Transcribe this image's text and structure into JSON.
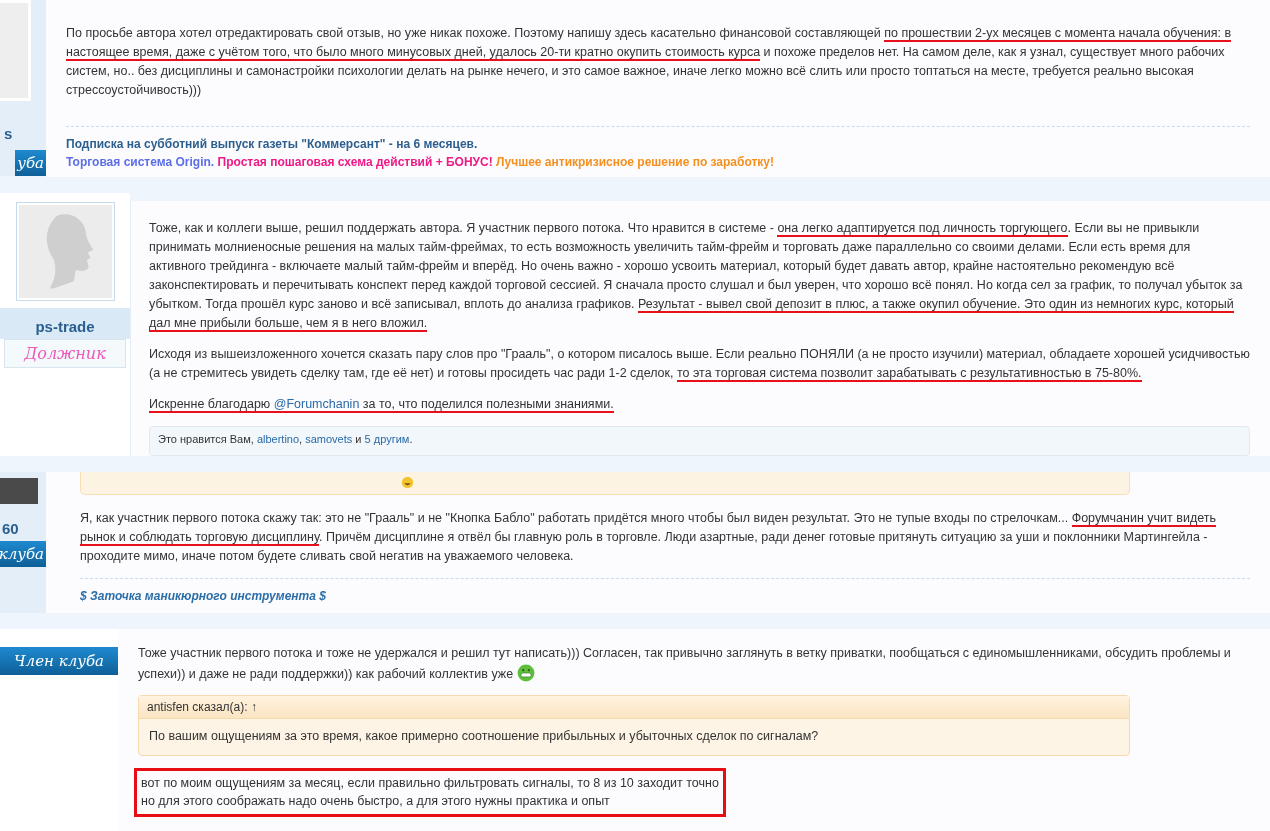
{
  "posts": [
    {
      "author": {
        "name": "s",
        "rank": {
          "text": "уба",
          "kind": "ribbon"
        },
        "avatar": {
          "kind": "blank"
        }
      },
      "paragraphs": [
        {
          "segments": [
            {
              "text": "По просьбе автора хотел отредактировать свой отзыв, но уже никак похоже. Поэтому напишу здесь касательно финансовой составляющей ",
              "marked": false
            },
            {
              "text": "по прошествии 2-ух месяцев с момента начала обучения: в настоящее время, даже с учётом того, что было много минусовых дней, удалось 20-ти кратно окупить стоимость курса",
              "marked": true
            },
            {
              "text": " и похоже пределов нет. На самом деле, как я узнал, существует много рабочих систем, но.. без дисциплины и самонастройки психологии делать на рынке нечего, и это самое важное, иначе легко можно всё слить или просто топтаться на месте, требуется реально высокая стрессоустойчивость)))",
              "marked": false
            }
          ]
        }
      ],
      "signature": [
        {
          "kind": "bold",
          "parts": [
            {
              "text": "Подписка на субботний выпуск газеты \"Коммерсант\" - на 6 месяцев.",
              "color": "#2d5f8e"
            }
          ]
        },
        {
          "kind": "bold",
          "parts": [
            {
              "text": "Торговая система Origin.",
              "color": "#5b6ee8"
            },
            {
              "text": "Простая пошаговая схема действий + БОНУС!",
              "color": "#ee1a86"
            },
            {
              "text": "Лучшее антикризисное решение по заработку!",
              "color": "#f5901e"
            }
          ]
        }
      ]
    },
    {
      "author": {
        "name": "ps-trade",
        "rank": {
          "text": "Должник",
          "kind": "plain"
        },
        "avatar": {
          "kind": "silhouette"
        }
      },
      "paragraphs": [
        {
          "segments": [
            {
              "text": "Тоже, как и коллеги выше, решил поддержать автора. Я участник первого потока. Что нравится в системе - ",
              "marked": false
            },
            {
              "text": "она легко адаптируется под личность торгующего",
              "marked": true
            },
            {
              "text": ". Если вы не привыкли принимать молниеносные решения на малых тайм-фреймах, то есть возможность увеличить тайм-фрейм и торговать даже параллельно со своими делами. Если есть время для активного трейдинга - включаете малый тайм-фрейм и вперёд. Но очень важно - хорошо усвоить материал, который будет давать автор, крайне настоятельно рекомендую всё законспектировать и перечитывать конспект перед каждой торговой сессией. Я сначала просто слушал и был уверен, что хорошо всё понял. Но когда сел за график, то получал убыток за убытком. Тогда прошёл курс заново и всё записывал, вплоть до анализа графиков. ",
              "marked": false
            },
            {
              "text": "Результат - вывел свой депозит в плюс, а также окупил обучение. Это один из немногих курс, который дал мне прибыли больше, чем я в него вложил.",
              "marked": true
            }
          ]
        },
        {
          "segments": [
            {
              "text": "Исходя из вышеизложенного хочется сказать пару слов про \"Грааль\", о котором писалось выше. Если реально ПОНЯЛИ (а не просто изучили) материал, обладаете хорошей усидчивостью (а не стремитесь увидеть сделку там, где её нет) и готовы просидеть час ради 1-2 сделок, ",
              "marked": false
            },
            {
              "text": "то эта торговая система позволит зарабатывать с результативностью в 75-80%.",
              "marked": true
            }
          ]
        },
        {
          "segments": [
            {
              "text": "Искренне благодарю ",
              "marked": true
            },
            {
              "text": "@Forumchanin",
              "marked": true,
              "link": true
            },
            {
              "text": " за то, что поделился полезными знаниями.",
              "marked": true
            }
          ]
        }
      ],
      "likes": [
        {
          "text": "Это нравится ",
          "link": false
        },
        {
          "text": "Вам",
          "link": false
        },
        {
          "text": ", ",
          "link": false
        },
        {
          "text": "albertino",
          "link": true
        },
        {
          "text": ", ",
          "link": false
        },
        {
          "text": "samovets",
          "link": true
        },
        {
          "text": " и ",
          "link": false
        },
        {
          "text": "5 другим",
          "link": true
        },
        {
          "text": ".",
          "link": false
        }
      ]
    },
    {
      "author": {
        "name": "60",
        "rank": {
          "text": "клуба",
          "kind": "ribbon"
        },
        "avatar": {
          "kind": "photo"
        }
      },
      "quote_stub": true,
      "paragraphs": [
        {
          "segments": [
            {
              "text": "Я, как участник первого потока скажу так: это не \"Грааль\" и не \"Кнопка Бабло\" работать придётся много чтобы был виден результат. Это не тупые входы по стрелочкам... ",
              "marked": false
            },
            {
              "text": "Форумчанин учит видеть рынок и соблюдать торговую дисциплину",
              "marked": true
            },
            {
              "text": ". Причём дисциплине я отвёл бы главную роль в торговле. Люди азартные, ради денег готовые притянуть ситуацию за уши и поклонники Мартингейла - проходите мимо, иначе потом будете сливать свой негатив на уважаемого человека.",
              "marked": false
            }
          ]
        }
      ],
      "signature": [
        {
          "kind": "italic",
          "parts": [
            {
              "text": "$ Заточка маникюрного инструмента $",
              "color": "#2c6ea8"
            }
          ]
        }
      ]
    },
    {
      "author": {
        "rank": {
          "text": "Член клуба",
          "kind": "ribbon"
        }
      },
      "paragraphs": [
        {
          "smiley": true,
          "segments": [
            {
              "text": "Тоже участник первого потока и тоже не удержался и решил тут написать))) Согласен, так привычно заглянуть в ветку приватки, пообщаться с единомышленниками, обсудить проблемы и успехи)) и даже не ради поддержки)) как рабочий коллектив уже",
              "marked": false
            }
          ]
        }
      ],
      "quote": {
        "author": "antisfen сказал(а): ↑",
        "text": "По вашим ощущениям за это время, какое примерно соотношение прибыльных и убыточных сделок по сигналам?"
      },
      "answer": {
        "boxed": true,
        "lines": [
          "вот по моим ощущениям за месяц, если правильно фильтровать сигналы, то 8 из 10 заходит точно",
          "но для этого соображать надо очень быстро, а для этого нужны практика и опыт"
        ]
      }
    }
  ]
}
